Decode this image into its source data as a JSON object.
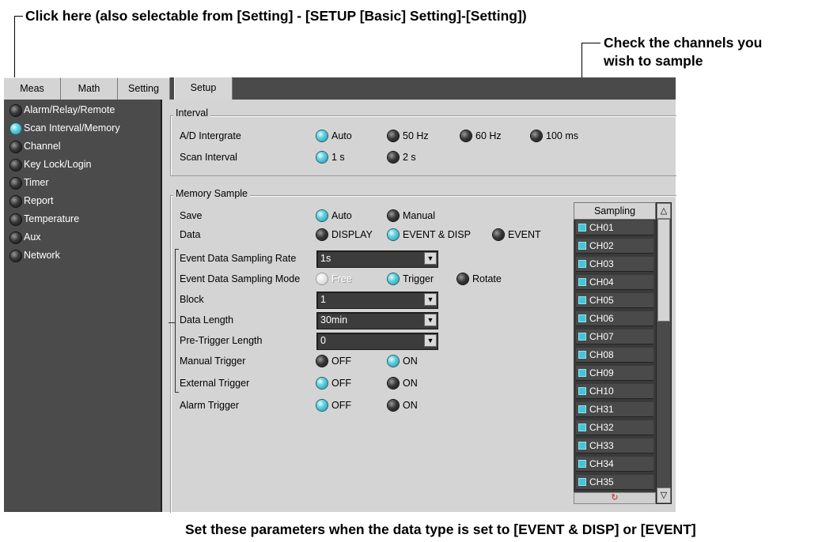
{
  "callouts": {
    "top": "Click here (also selectable from [Setting] - [SETUP [Basic] Setting]-[Setting])",
    "right_line1": "Check the channels you",
    "right_line2": "wish to sample",
    "bottom": "Set these parameters when the data type is set to [EVENT & DISP] or [EVENT]"
  },
  "tabs": [
    {
      "label": "Meas",
      "active": false
    },
    {
      "label": "Math",
      "active": false
    },
    {
      "label": "Setting",
      "active": false
    },
    {
      "label": "Setup",
      "active": true
    }
  ],
  "sidebar": {
    "items": [
      {
        "label": "Alarm/Relay/Remote",
        "selected": false
      },
      {
        "label": "Scan Interval/Memory",
        "selected": true
      },
      {
        "label": "Channel",
        "selected": false
      },
      {
        "label": "Key Lock/Login",
        "selected": false
      },
      {
        "label": "Timer",
        "selected": false
      },
      {
        "label": "Report",
        "selected": false
      },
      {
        "label": "Temperature",
        "selected": false
      },
      {
        "label": "Aux",
        "selected": false
      },
      {
        "label": "Network",
        "selected": false
      }
    ]
  },
  "interval": {
    "title": "Interval",
    "ad_label": "A/D Intergrate",
    "ad_options": [
      {
        "label": "Auto",
        "selected": true
      },
      {
        "label": "50 Hz",
        "selected": false
      },
      {
        "label": "60 Hz",
        "selected": false
      },
      {
        "label": "100 ms",
        "selected": false
      }
    ],
    "scan_label": "Scan Interval",
    "scan_options": [
      {
        "label": "1 s",
        "selected": true
      },
      {
        "label": "2 s",
        "selected": false
      }
    ]
  },
  "memory": {
    "title": "Memory Sample",
    "save_label": "Save",
    "save_options": [
      {
        "label": "Auto",
        "selected": true
      },
      {
        "label": "Manual",
        "selected": false
      }
    ],
    "data_label": "Data",
    "data_options": [
      {
        "label": "DISPLAY",
        "selected": false
      },
      {
        "label": "EVENT & DISP",
        "selected": true
      },
      {
        "label": "EVENT",
        "selected": false
      }
    ],
    "rate_label": "Event Data Sampling Rate",
    "rate_value": "1s",
    "mode_label": "Event Data Sampling Mode",
    "mode_options": [
      {
        "label": "Free",
        "state": "disabled"
      },
      {
        "label": "Trigger",
        "state": "selected"
      },
      {
        "label": "Rotate",
        "state": "off"
      }
    ],
    "block_label": "Block",
    "block_value": "1",
    "length_label": "Data Length",
    "length_value": "30min",
    "pretrig_label": "Pre-Trigger Length",
    "pretrig_value": "0",
    "manual_label": "Manual Trigger",
    "manual_options": [
      {
        "label": "OFF",
        "selected": false
      },
      {
        "label": "ON",
        "selected": true
      }
    ],
    "external_label": "External Trigger",
    "external_options": [
      {
        "label": "OFF",
        "selected": true
      },
      {
        "label": "ON",
        "selected": false
      }
    ],
    "alarm_label": "Alarm Trigger",
    "alarm_options": [
      {
        "label": "OFF",
        "selected": true
      },
      {
        "label": "ON",
        "selected": false
      }
    ]
  },
  "sampling": {
    "header": "Sampling",
    "channels": [
      "CH01",
      "CH02",
      "CH03",
      "CH04",
      "CH05",
      "CH06",
      "CH07",
      "CH08",
      "CH09",
      "CH10",
      "CH31",
      "CH32",
      "CH33",
      "CH34",
      "CH35"
    ],
    "footer_icon": "refresh-icon",
    "scroll_up_glyph": "△",
    "scroll_down_glyph": "▽"
  },
  "colors": {
    "radio_on": "#4fc3d6",
    "panel_bg": "#d4d4d4",
    "window_bg": "#4a4a4a"
  }
}
